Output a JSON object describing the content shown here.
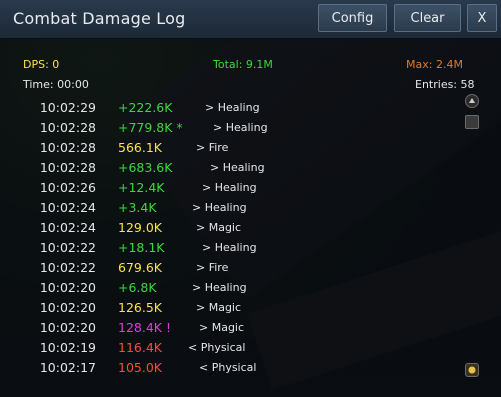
{
  "window": {
    "title": "Combat Damage Log",
    "buttons": {
      "config": "Config",
      "clear": "Clear",
      "close": "X"
    }
  },
  "stats": {
    "dps": "DPS: 0",
    "total": "Total: 9.1M",
    "max": "Max: 2.4M",
    "time": "Time: 00:00",
    "entries": "Entries: 58"
  },
  "colors": {
    "green": "#3ed63e",
    "yellow": "#ffe24a",
    "magenta": "#e23ae2",
    "red": "#ff4a3a",
    "max_orange": "#e07a2a",
    "total_green": "#3ed63e",
    "dps_yellow": "#ffe24a"
  },
  "log": [
    {
      "time": "10:02:29",
      "amount": "+222.6K",
      "type": "> Healing",
      "color": "green"
    },
    {
      "time": "10:02:28",
      "amount": "+779.8K *",
      "type": "> Healing",
      "color": "green"
    },
    {
      "time": "10:02:28",
      "amount": "566.1K",
      "type": "> Fire",
      "color": "yellow"
    },
    {
      "time": "10:02:28",
      "amount": "+683.6K",
      "type": "> Healing",
      "color": "green"
    },
    {
      "time": "10:02:26",
      "amount": "+12.4K",
      "type": "> Healing",
      "color": "green"
    },
    {
      "time": "10:02:24",
      "amount": "+3.4K",
      "type": "> Healing",
      "color": "green"
    },
    {
      "time": "10:02:24",
      "amount": "129.0K",
      "type": "> Magic",
      "color": "yellow"
    },
    {
      "time": "10:02:22",
      "amount": "+18.1K",
      "type": "> Healing",
      "color": "green"
    },
    {
      "time": "10:02:22",
      "amount": "679.6K",
      "type": "> Fire",
      "color": "yellow"
    },
    {
      "time": "10:02:20",
      "amount": "+6.8K",
      "type": "> Healing",
      "color": "green"
    },
    {
      "time": "10:02:20",
      "amount": "126.5K",
      "type": "> Magic",
      "color": "yellow"
    },
    {
      "time": "10:02:20",
      "amount": "128.4K !",
      "type": "> Magic",
      "color": "magenta"
    },
    {
      "time": "10:02:19",
      "amount": "116.4K",
      "type": "< Physical",
      "color": "red"
    },
    {
      "time": "10:02:17",
      "amount": "105.0K",
      "type": "< Physical",
      "color": "red"
    }
  ],
  "icons": {
    "scroll_up": "scroll-up-icon",
    "scroll_handle": "scroll-thumb-icon",
    "bottom": "compass-icon"
  }
}
